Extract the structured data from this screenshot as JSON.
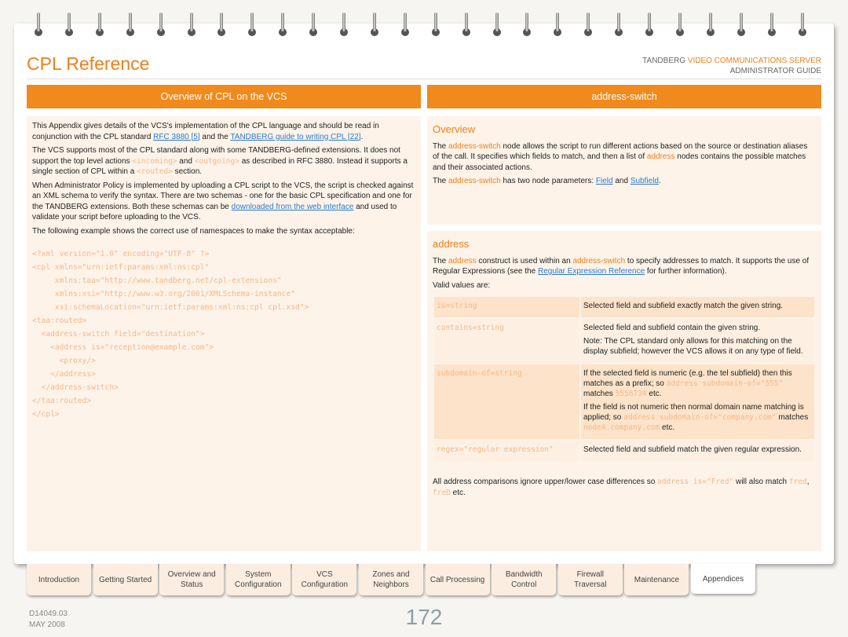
{
  "header": {
    "title": "CPL Reference",
    "brand_prefix": "TANDBERG ",
    "brand_product": "VIDEO COMMUNICATIONS SERVER",
    "brand_sub": "ADMINISTRATOR GUIDE"
  },
  "left": {
    "heading": "Overview of CPL on the VCS",
    "paragraphs": [
      [
        {
          "t": "This Appendix gives details of the VCS's implementation of the CPL language and should be read in conjunction with the CPL standard "
        },
        {
          "t": "RFC 3880 [5]",
          "s": "link"
        },
        {
          "t": " and the "
        },
        {
          "t": "TANDBERG guide to writing CPL [22]",
          "s": "link"
        },
        {
          "t": "."
        }
      ],
      [
        {
          "t": "The VCS supports most of the CPL standard along with some TANDBERG-defined extensions.  It does not support the top level actions "
        },
        {
          "t": "<incoming>",
          "s": "code"
        },
        {
          "t": " and "
        },
        {
          "t": "<outgoing>",
          "s": "code"
        },
        {
          "t": " as described in RFC 3880.  Instead it supports a single section of CPL within a "
        },
        {
          "t": "<routed>",
          "s": "code"
        },
        {
          "t": " section."
        }
      ],
      [
        {
          "t": "When Administrator Policy is implemented by uploading a CPL script to the VCS, the script is checked against an XML schema to verify the syntax. There are two schemas - one for the basic CPL specification and one for the TANDBERG extensions.  Both these schemas can be "
        },
        {
          "t": "downloaded from the web interface",
          "s": "link"
        },
        {
          "t": " and used to validate your script before uploading to the VCS."
        }
      ],
      [
        {
          "t": "The following example shows the correct use of namespaces to make the syntax acceptable:"
        }
      ]
    ],
    "xml_lines": [
      "<?xml version=\"1.0\" encoding=\"UTF-8\" ?>",
      "<cpl xmlns=\"urn:ietf:params:xml:ns:cpl\"",
      "     xmlns:taa=\"http://www.tandberg.net/cpl-extensions\"",
      "     xmlns:xsi=\"http://www.w3.org/2001/XMLSchema-instance\"",
      "     xsi:schemaLocation=\"urn:ietf:params:xml:ns:cpl cpl.xsd\">",
      "<taa:routed>",
      "  <address-switch field=\"destination\">",
      "    <address is=\"reception@example.com\">",
      "      <proxy/>",
      "    </address>",
      "  </address-switch>",
      "</taa:routed>",
      "</cpl>"
    ]
  },
  "right": {
    "heading": "address-switch",
    "overview": {
      "title": "Overview",
      "paragraphs": [
        [
          {
            "t": "The "
          },
          {
            "t": "address-switch",
            "s": "or"
          },
          {
            "t": " node allows the script to run different actions based on the source or destination aliases of the call. It specifies which fields to match, and then a list of "
          },
          {
            "t": "address",
            "s": "or"
          },
          {
            "t": " nodes contains the possible matches and their associated actions."
          }
        ],
        [
          {
            "t": "The "
          },
          {
            "t": "address-switch",
            "s": "or"
          },
          {
            "t": " has two node parameters: "
          },
          {
            "t": "Field",
            "s": "link"
          },
          {
            "t": " and "
          },
          {
            "t": "Subfield",
            "s": "link"
          },
          {
            "t": "."
          }
        ]
      ]
    },
    "address": {
      "title": "address",
      "paragraphs": [
        [
          {
            "t": "The "
          },
          {
            "t": "address",
            "s": "or"
          },
          {
            "t": " construct is used within an "
          },
          {
            "t": "address-switch",
            "s": "or"
          },
          {
            "t": " to specify addresses to match. It supports the use of Regular Expressions (see the "
          },
          {
            "t": "Regular Expression Reference",
            "s": "link"
          },
          {
            "t": " for further information)."
          }
        ],
        [
          {
            "t": "Valid values are:"
          }
        ]
      ],
      "table": [
        {
          "key": "is=string",
          "desc": [
            [
              {
                "t": "Selected field and subfield exactly match the given string."
              }
            ]
          ]
        },
        {
          "key": "contains=string",
          "desc": [
            [
              {
                "t": "Selected field and subfield contain the given string."
              }
            ],
            [
              {
                "t": "Note: The CPL standard only allows for this matching on the display subfield; however the VCS allows it on any type of field."
              }
            ]
          ]
        },
        {
          "key": "subdomain-of=string",
          "desc": [
            [
              {
                "t": "If the selected field is numeric (e.g. the tel subfield) then this matches as a prefix; so "
              },
              {
                "t": "address subdomain-of=\"555\"",
                "s": "code"
              },
              {
                "t": " matches "
              },
              {
                "t": "5556734",
                "s": "code"
              },
              {
                "t": " etc."
              }
            ],
            [
              {
                "t": "If the field is not numeric then normal domain name matching is applied; so "
              },
              {
                "t": "address subdomain-of=\"company.com\"",
                "s": "code"
              },
              {
                "t": " matches "
              },
              {
                "t": "nodeA.company.com",
                "s": "code"
              },
              {
                "t": " etc."
              }
            ]
          ]
        },
        {
          "key": "regex=\"regular expression\"",
          "desc": [
            [
              {
                "t": "Selected field and subfield match the given regular expression."
              }
            ]
          ]
        }
      ],
      "footer": [
        {
          "t": "All address comparisons ignore upper/lower case differences so "
        },
        {
          "t": "address is=\"Fred\"",
          "s": "code"
        },
        {
          "t": " will also match "
        },
        {
          "t": "fred",
          "s": "code"
        },
        {
          "t": ", "
        },
        {
          "t": "freD",
          "s": "code"
        },
        {
          "t": " etc."
        }
      ]
    }
  },
  "tabs": [
    {
      "label": "Introduction"
    },
    {
      "label": "Getting Started"
    },
    {
      "label": "Overview and Status"
    },
    {
      "label": "System Configuration"
    },
    {
      "label": "VCS Configuration"
    },
    {
      "label": "Zones and Neighbors"
    },
    {
      "label": "Call Processing"
    },
    {
      "label": "Bandwidth Control"
    },
    {
      "label": "Firewall Traversal"
    },
    {
      "label": "Maintenance"
    },
    {
      "label": "Appendices",
      "active": true
    }
  ],
  "footer": {
    "doc_id": "D14049.03",
    "date": "MAY 2008",
    "page_number": "172"
  },
  "colors": {
    "accent": "#f08a1c",
    "panel": "#fdf3e9",
    "link": "#2a7bd0"
  }
}
